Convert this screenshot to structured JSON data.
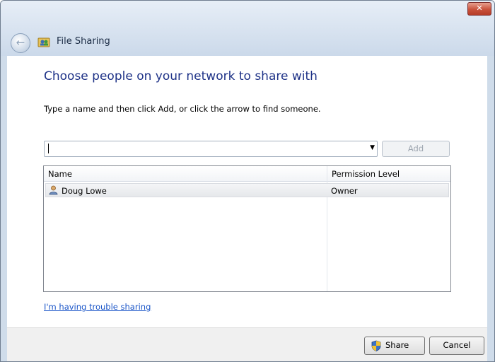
{
  "window": {
    "title": "File Sharing",
    "close_label": "✕"
  },
  "icons": {
    "back": "back-arrow-icon",
    "title": "file-sharing-icon",
    "user": "user-icon",
    "shield": "uac-shield-icon",
    "dropdown": "dropdown-arrow-icon"
  },
  "main": {
    "heading": "Choose people on your network to share with",
    "instruction": "Type a name and then click Add, or click the arrow to find someone.",
    "name_input": {
      "value": ""
    },
    "add_button": {
      "label": "Add",
      "enabled": false
    },
    "list": {
      "columns": [
        "Name",
        "Permission Level"
      ],
      "rows": [
        {
          "name": "Doug Lowe",
          "permission": "Owner"
        }
      ]
    },
    "trouble_link": "I'm having trouble sharing"
  },
  "footer": {
    "share_label": "Share",
    "cancel_label": "Cancel"
  },
  "colors": {
    "heading": "#1e3287",
    "link": "#1a55c8",
    "close_button": "#c9523c"
  }
}
